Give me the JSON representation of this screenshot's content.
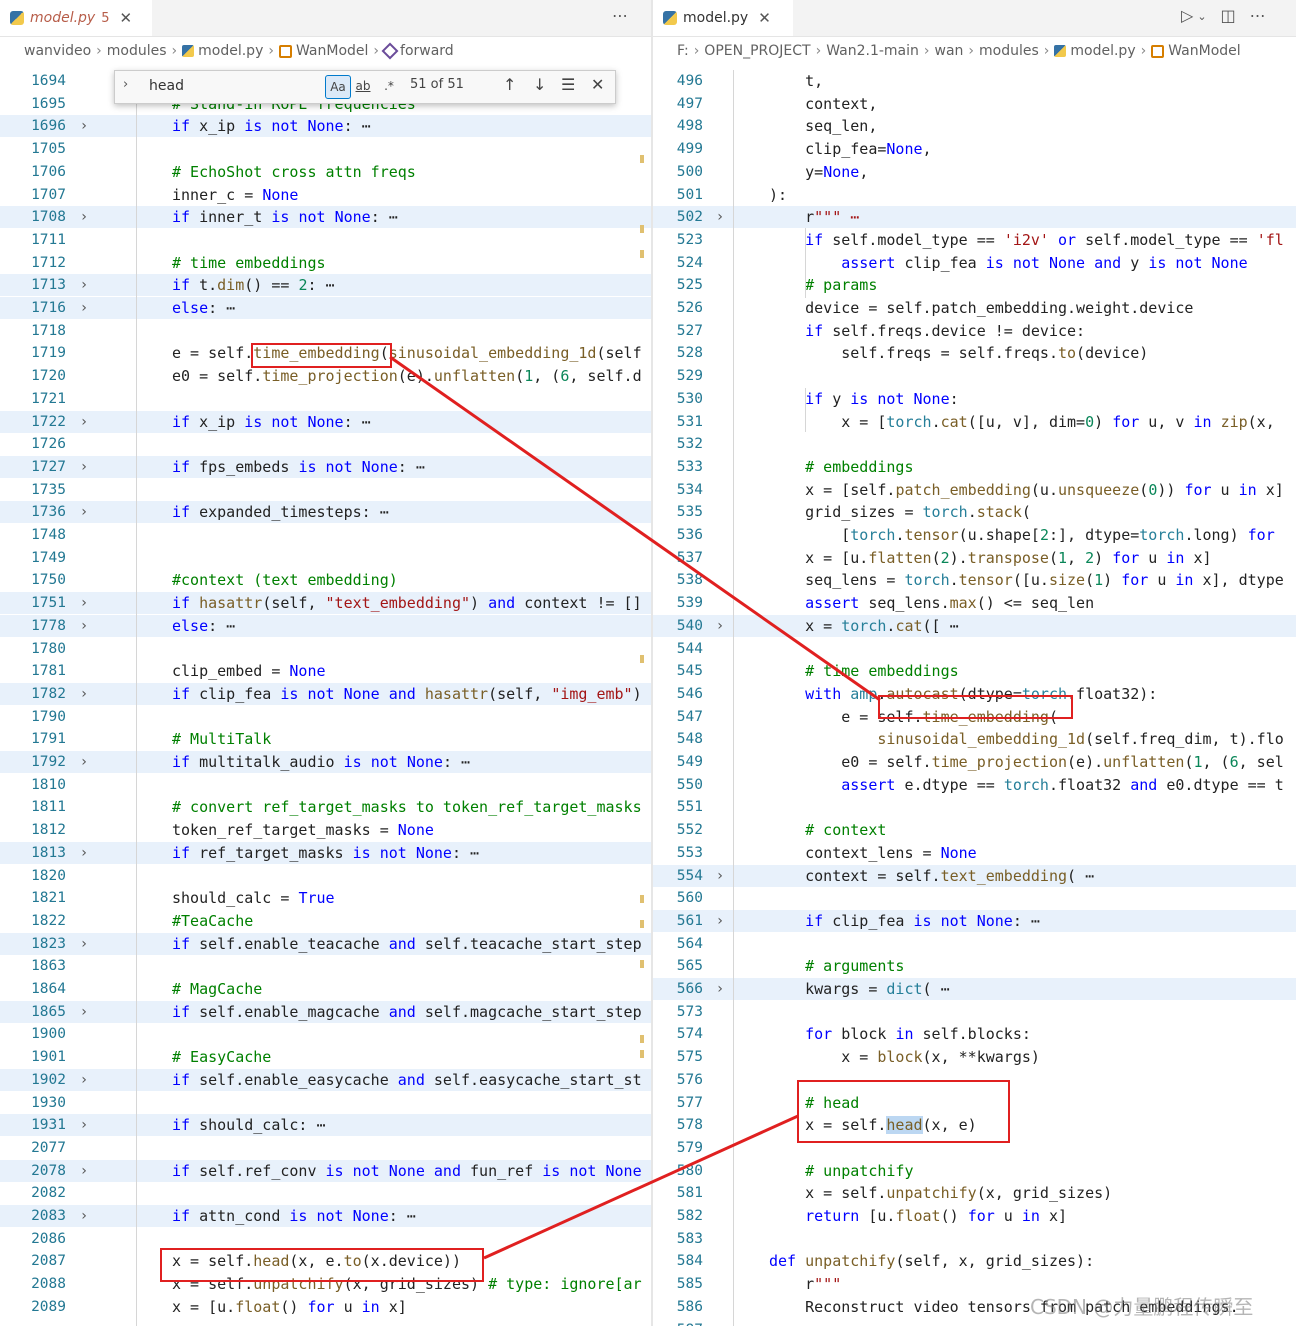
{
  "left": {
    "tab": {
      "file": "model.py",
      "badge": "5"
    },
    "breadcrumbs": [
      "wanvideo",
      "modules",
      "model.py",
      "WanModel",
      "forward"
    ],
    "find": {
      "query": "head",
      "opt_case": "Aa",
      "opt_word": "ab",
      "opt_regex": ".*",
      "count": "51 of 51"
    },
    "lines": [
      {
        "n": "1694",
        "code": "",
        "fold": false
      },
      {
        "n": "1695",
        "code": "# Stand-in RoPE frequencies",
        "fold": false
      },
      {
        "n": "1696",
        "code": "if x_ip is not None: ⋯",
        "fold": true
      },
      {
        "n": "1705",
        "code": "",
        "fold": false
      },
      {
        "n": "1706",
        "code": "# EchoShot cross attn freqs",
        "fold": false
      },
      {
        "n": "1707",
        "code": "inner_c = None",
        "fold": false
      },
      {
        "n": "1708",
        "code": "if inner_t is not None: ⋯",
        "fold": true
      },
      {
        "n": "1711",
        "code": "",
        "fold": false
      },
      {
        "n": "1712",
        "code": "# time embeddings",
        "fold": false
      },
      {
        "n": "1713",
        "code": "if t.dim() == 2: ⋯",
        "fold": true
      },
      {
        "n": "1716",
        "code": "else: ⋯",
        "fold": true
      },
      {
        "n": "1718",
        "code": "",
        "fold": false
      },
      {
        "n": "1719",
        "code": "e = self.time_embedding(sinusoidal_embedding_1d(self",
        "fold": false
      },
      {
        "n": "1720",
        "code": "e0 = self.time_projection(e).unflatten(1, (6, self.d",
        "fold": false
      },
      {
        "n": "1721",
        "code": "",
        "fold": false
      },
      {
        "n": "1722",
        "code": "if x_ip is not None: ⋯",
        "fold": true
      },
      {
        "n": "1726",
        "code": "",
        "fold": false
      },
      {
        "n": "1727",
        "code": "if fps_embeds is not None: ⋯",
        "fold": true
      },
      {
        "n": "1735",
        "code": "",
        "fold": false
      },
      {
        "n": "1736",
        "code": "if expanded_timesteps: ⋯",
        "fold": true
      },
      {
        "n": "1748",
        "code": "",
        "fold": false
      },
      {
        "n": "1749",
        "code": "",
        "fold": false
      },
      {
        "n": "1750",
        "code": "#context (text embedding)",
        "fold": false
      },
      {
        "n": "1751",
        "code": "if hasattr(self, \"text_embedding\") and context != []",
        "fold": true
      },
      {
        "n": "1778",
        "code": "else: ⋯",
        "fold": true
      },
      {
        "n": "1780",
        "code": "",
        "fold": false
      },
      {
        "n": "1781",
        "code": "clip_embed = None",
        "fold": false
      },
      {
        "n": "1782",
        "code": "if clip_fea is not None and hasattr(self, \"img_emb\")",
        "fold": true
      },
      {
        "n": "1790",
        "code": "",
        "fold": false
      },
      {
        "n": "1791",
        "code": "# MultiTalk",
        "fold": false
      },
      {
        "n": "1792",
        "code": "if multitalk_audio is not None: ⋯",
        "fold": true
      },
      {
        "n": "1810",
        "code": "",
        "fold": false
      },
      {
        "n": "1811",
        "code": "# convert ref_target_masks to token_ref_target_masks",
        "fold": false
      },
      {
        "n": "1812",
        "code": "token_ref_target_masks = None",
        "fold": false
      },
      {
        "n": "1813",
        "code": "if ref_target_masks is not None: ⋯",
        "fold": true
      },
      {
        "n": "1820",
        "code": "",
        "fold": false
      },
      {
        "n": "1821",
        "code": "should_calc = True",
        "fold": false
      },
      {
        "n": "1822",
        "code": "#TeaCache",
        "fold": false
      },
      {
        "n": "1823",
        "code": "if self.enable_teacache and self.teacache_start_step",
        "fold": true
      },
      {
        "n": "1863",
        "code": "",
        "fold": false
      },
      {
        "n": "1864",
        "code": "# MagCache",
        "fold": false
      },
      {
        "n": "1865",
        "code": "if self.enable_magcache and self.magcache_start_step",
        "fold": true
      },
      {
        "n": "1900",
        "code": "",
        "fold": false
      },
      {
        "n": "1901",
        "code": "# EasyCache",
        "fold": false
      },
      {
        "n": "1902",
        "code": "if self.enable_easycache and self.easycache_start_st",
        "fold": true
      },
      {
        "n": "1930",
        "code": "",
        "fold": false
      },
      {
        "n": "1931",
        "code": "if should_calc: ⋯",
        "fold": true
      },
      {
        "n": "2077",
        "code": "",
        "fold": false
      },
      {
        "n": "2078",
        "code": "if self.ref_conv is not None and fun_ref is not None",
        "fold": true
      },
      {
        "n": "2082",
        "code": "",
        "fold": false
      },
      {
        "n": "2083",
        "code": "if attn_cond is not None: ⋯",
        "fold": true
      },
      {
        "n": "2086",
        "code": "",
        "fold": false
      },
      {
        "n": "2087",
        "code": "x = self.head(x, e.to(x.device))",
        "fold": false
      },
      {
        "n": "2088",
        "code": "x = self.unpatchify(x, grid_sizes) # type: ignore[ar",
        "fold": false
      },
      {
        "n": "2089",
        "code": "x = [u.float() for u in x]",
        "fold": false
      }
    ]
  },
  "right": {
    "tab": {
      "file": "model.py"
    },
    "breadcrumbs": [
      "F:",
      "OPEN_PROJECT",
      "Wan2.1-main",
      "wan",
      "modules",
      "model.py",
      "WanModel"
    ],
    "lines": [
      {
        "n": "496",
        "code": "    t,",
        "fold": false
      },
      {
        "n": "497",
        "code": "    context,",
        "fold": false
      },
      {
        "n": "498",
        "code": "    seq_len,",
        "fold": false
      },
      {
        "n": "499",
        "code": "    clip_fea=None,",
        "fold": false
      },
      {
        "n": "500",
        "code": "    y=None,",
        "fold": false
      },
      {
        "n": "501",
        "code": "):",
        "fold": false
      },
      {
        "n": "502",
        "code": "    r\"\"\" ⋯",
        "fold": true
      },
      {
        "n": "523",
        "code": "    if self.model_type == 'i2v' or self.model_type == 'fl",
        "fold": false
      },
      {
        "n": "524",
        "code": "        assert clip_fea is not None and y is not None",
        "fold": false
      },
      {
        "n": "525",
        "code": "    # params",
        "fold": false
      },
      {
        "n": "526",
        "code": "    device = self.patch_embedding.weight.device",
        "fold": false
      },
      {
        "n": "527",
        "code": "    if self.freqs.device != device:",
        "fold": false
      },
      {
        "n": "528",
        "code": "        self.freqs = self.freqs.to(device)",
        "fold": false
      },
      {
        "n": "529",
        "code": "",
        "fold": false
      },
      {
        "n": "530",
        "code": "    if y is not None:",
        "fold": false
      },
      {
        "n": "531",
        "code": "        x = [torch.cat([u, v], dim=0) for u, v in zip(x,",
        "fold": false
      },
      {
        "n": "532",
        "code": "",
        "fold": false
      },
      {
        "n": "533",
        "code": "    # embeddings",
        "fold": false
      },
      {
        "n": "534",
        "code": "    x = [self.patch_embedding(u.unsqueeze(0)) for u in x]",
        "fold": false
      },
      {
        "n": "535",
        "code": "    grid_sizes = torch.stack(",
        "fold": false
      },
      {
        "n": "536",
        "code": "        [torch.tensor(u.shape[2:], dtype=torch.long) for",
        "fold": false
      },
      {
        "n": "537",
        "code": "    x = [u.flatten(2).transpose(1, 2) for u in x]",
        "fold": false
      },
      {
        "n": "538",
        "code": "    seq_lens = torch.tensor([u.size(1) for u in x], dtype",
        "fold": false
      },
      {
        "n": "539",
        "code": "    assert seq_lens.max() <= seq_len",
        "fold": false
      },
      {
        "n": "540",
        "code": "    x = torch.cat([ ⋯",
        "fold": true
      },
      {
        "n": "544",
        "code": "",
        "fold": false
      },
      {
        "n": "545",
        "code": "    # time embeddings",
        "fold": false
      },
      {
        "n": "546",
        "code": "    with amp.autocast(dtype=torch.float32):",
        "fold": false
      },
      {
        "n": "547",
        "code": "        e = self.time_embedding(",
        "fold": false
      },
      {
        "n": "548",
        "code": "            sinusoidal_embedding_1d(self.freq_dim, t).flo",
        "fold": false
      },
      {
        "n": "549",
        "code": "        e0 = self.time_projection(e).unflatten(1, (6, sel",
        "fold": false
      },
      {
        "n": "550",
        "code": "        assert e.dtype == torch.float32 and e0.dtype == t",
        "fold": false
      },
      {
        "n": "551",
        "code": "",
        "fold": false
      },
      {
        "n": "552",
        "code": "    # context",
        "fold": false
      },
      {
        "n": "553",
        "code": "    context_lens = None",
        "fold": false
      },
      {
        "n": "554",
        "code": "    context = self.text_embedding( ⋯",
        "fold": true
      },
      {
        "n": "560",
        "code": "",
        "fold": false
      },
      {
        "n": "561",
        "code": "    if clip_fea is not None: ⋯",
        "fold": true
      },
      {
        "n": "564",
        "code": "",
        "fold": false
      },
      {
        "n": "565",
        "code": "    # arguments",
        "fold": false
      },
      {
        "n": "566",
        "code": "    kwargs = dict( ⋯",
        "fold": true
      },
      {
        "n": "573",
        "code": "",
        "fold": false
      },
      {
        "n": "574",
        "code": "    for block in self.blocks:",
        "fold": false
      },
      {
        "n": "575",
        "code": "        x = block(x, **kwargs)",
        "fold": false
      },
      {
        "n": "576",
        "code": "",
        "fold": false
      },
      {
        "n": "577",
        "code": "    # head",
        "fold": false
      },
      {
        "n": "578",
        "code": "    x = self.head(x, e)",
        "fold": false
      },
      {
        "n": "579",
        "code": "",
        "fold": false
      },
      {
        "n": "580",
        "code": "    # unpatchify",
        "fold": false
      },
      {
        "n": "581",
        "code": "    x = self.unpatchify(x, grid_sizes)",
        "fold": false
      },
      {
        "n": "582",
        "code": "    return [u.float() for u in x]",
        "fold": false
      },
      {
        "n": "583",
        "code": "",
        "fold": false
      },
      {
        "n": "584",
        "code": "def unpatchify(self, x, grid_sizes):",
        "fold": false
      },
      {
        "n": "585",
        "code": "    r\"\"\"",
        "fold": false
      },
      {
        "n": "586",
        "code": "    Reconstruct video tensors from patch embeddings.",
        "fold": false
      },
      {
        "n": "587",
        "code": "",
        "fold": false
      }
    ]
  },
  "watermark": "CSDN @力量鹏程传瞬至"
}
